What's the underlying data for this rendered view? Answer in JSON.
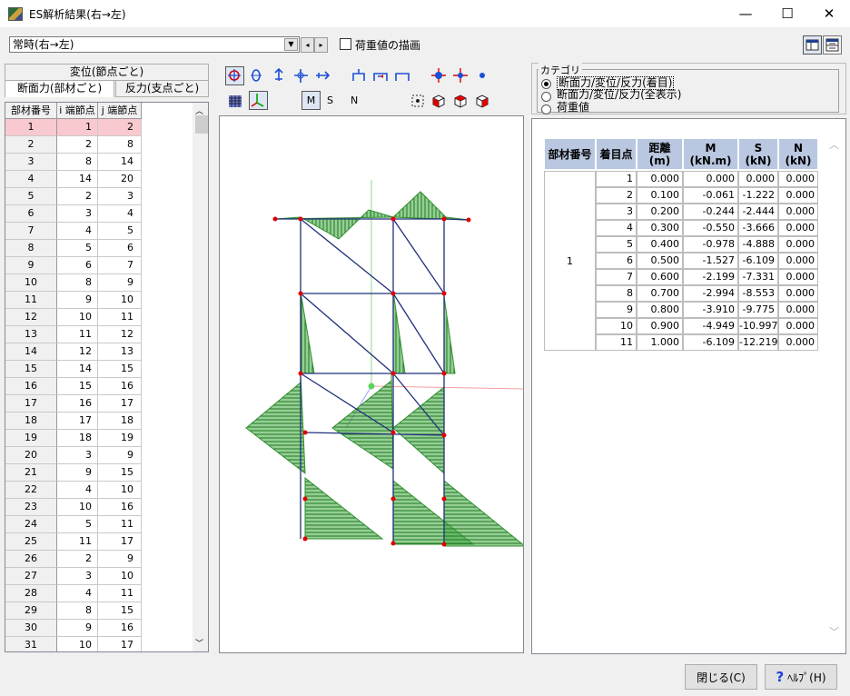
{
  "window": {
    "title": "ES解析結果(右→左)",
    "minimize": "—",
    "maximize": "☐",
    "close": "✕"
  },
  "toolbar": {
    "case_value": "常時(右→左)",
    "prev": "◂",
    "next": "▸",
    "draw_load_label": "荷重値の描画"
  },
  "left_tabs": {
    "row1": "変位(節点ごと)",
    "tab_member": "断面力(部材ごと)",
    "tab_support": "反力(支点ごと)"
  },
  "member_grid": {
    "headers": [
      "部材番号",
      "i 端節点",
      "j 端節点"
    ],
    "rows": [
      [
        "1",
        "1",
        "2"
      ],
      [
        "2",
        "2",
        "8"
      ],
      [
        "3",
        "8",
        "14"
      ],
      [
        "4",
        "14",
        "20"
      ],
      [
        "5",
        "2",
        "3"
      ],
      [
        "6",
        "3",
        "4"
      ],
      [
        "7",
        "4",
        "5"
      ],
      [
        "8",
        "5",
        "6"
      ],
      [
        "9",
        "6",
        "7"
      ],
      [
        "10",
        "8",
        "9"
      ],
      [
        "11",
        "9",
        "10"
      ],
      [
        "12",
        "10",
        "11"
      ],
      [
        "13",
        "11",
        "12"
      ],
      [
        "14",
        "12",
        "13"
      ],
      [
        "15",
        "14",
        "15"
      ],
      [
        "16",
        "15",
        "16"
      ],
      [
        "17",
        "16",
        "17"
      ],
      [
        "18",
        "17",
        "18"
      ],
      [
        "19",
        "18",
        "19"
      ],
      [
        "20",
        "3",
        "9"
      ],
      [
        "21",
        "9",
        "15"
      ],
      [
        "22",
        "4",
        "10"
      ],
      [
        "23",
        "10",
        "16"
      ],
      [
        "24",
        "5",
        "11"
      ],
      [
        "25",
        "11",
        "17"
      ],
      [
        "26",
        "2",
        "9"
      ],
      [
        "27",
        "3",
        "10"
      ],
      [
        "28",
        "4",
        "11"
      ],
      [
        "29",
        "8",
        "15"
      ],
      [
        "30",
        "9",
        "16"
      ],
      [
        "31",
        "10",
        "17"
      ]
    ]
  },
  "view_toggles": {
    "m": "M",
    "s": "S",
    "n": "N"
  },
  "category": {
    "title": "カテゴリ",
    "options": [
      "断面力/変位/反力(着目)",
      "断面力/変位/反力(全表示)",
      "荷重値"
    ],
    "selected": 0
  },
  "result_table": {
    "headers": [
      "部材番号",
      "着目点",
      "距離\n(m)",
      "M\n(kN.m)",
      "S\n(kN)",
      "N\n(kN)"
    ],
    "member": "1",
    "rows": [
      [
        "1",
        "0.000",
        "0.000",
        "0.000",
        "0.000"
      ],
      [
        "2",
        "0.100",
        "-0.061",
        "-1.222",
        "0.000"
      ],
      [
        "3",
        "0.200",
        "-0.244",
        "-2.444",
        "0.000"
      ],
      [
        "4",
        "0.300",
        "-0.550",
        "-3.666",
        "0.000"
      ],
      [
        "5",
        "0.400",
        "-0.978",
        "-4.888",
        "0.000"
      ],
      [
        "6",
        "0.500",
        "-1.527",
        "-6.109",
        "0.000"
      ],
      [
        "7",
        "0.600",
        "-2.199",
        "-7.331",
        "0.000"
      ],
      [
        "8",
        "0.700",
        "-2.994",
        "-8.553",
        "0.000"
      ],
      [
        "9",
        "0.800",
        "-3.910",
        "-9.775",
        "0.000"
      ],
      [
        "10",
        "0.900",
        "-4.949",
        "-10.997",
        "0.000"
      ],
      [
        "11",
        "1.000",
        "-6.109",
        "-12.219",
        "0.000"
      ]
    ]
  },
  "buttons": {
    "close": "閉じる(C)",
    "help": "ﾍﾙﾌﾟ(H)"
  },
  "colors": {
    "diagram_fill": "#3fa63f",
    "frame": "#1f2f7a",
    "node": "#e00000",
    "selected_row": "#f8c9cf"
  }
}
